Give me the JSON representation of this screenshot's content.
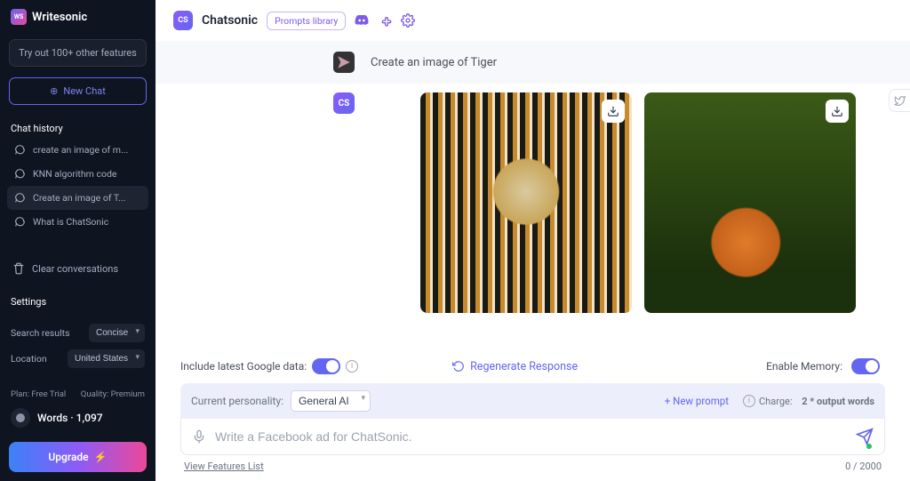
{
  "sidebar": {
    "brand": "Writesonic",
    "logo_text": "WS",
    "try_btn": "Try out 100+ other features",
    "new_chat": "New Chat",
    "history_label": "Chat history",
    "history": [
      {
        "label": "create an image of m..."
      },
      {
        "label": "KNN algorithm code"
      },
      {
        "label": "Create an image of T..."
      },
      {
        "label": "What is ChatSonic"
      }
    ],
    "clear": "Clear conversations",
    "settings_label": "Settings",
    "search_results_label": "Search results",
    "search_results_value": "Concise",
    "location_label": "Location",
    "location_value": "United States",
    "plan_label": "Plan: Free Trial",
    "quality_label": "Quality: Premium",
    "words_label": "Words",
    "words_count": "1,097",
    "upgrade": "Upgrade"
  },
  "header": {
    "avatar_text": "CS",
    "title": "Chatsonic",
    "prompts_library": "Prompts library"
  },
  "conversation": {
    "user_message": "Create an image of Tiger",
    "assistant_avatar": "CS"
  },
  "controls": {
    "include_google": "Include latest Google data:",
    "regenerate": "Regenerate Response",
    "enable_memory": "Enable Memory:",
    "personality_label": "Current personality:",
    "personality_value": "General AI",
    "new_prompt": "+ New prompt",
    "charge_label": "Charge:",
    "charge_value": "2 * output words",
    "input_placeholder": "Write a Facebook ad for ChatSonic.",
    "view_features": "View Features List",
    "char_count": "0 / 2000"
  }
}
